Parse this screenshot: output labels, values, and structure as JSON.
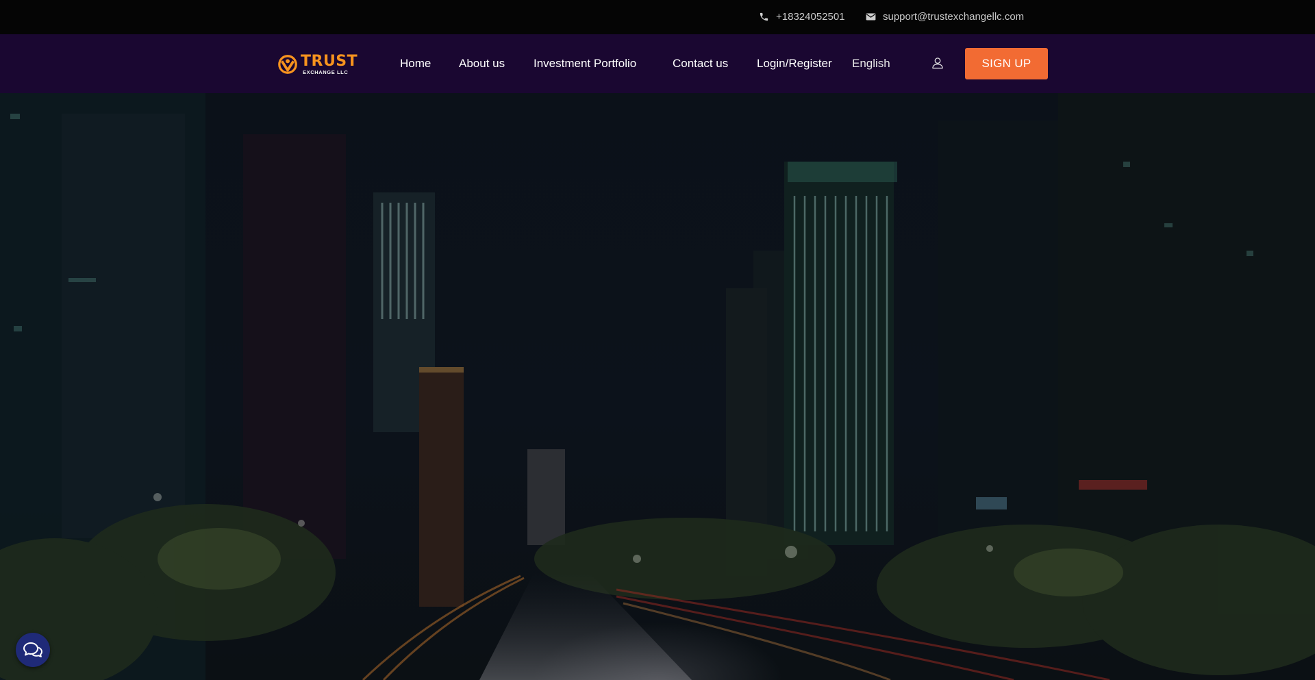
{
  "topbar": {
    "phone": "+18324052501",
    "email": "support@trustexchangellc.com",
    "phone_icon": "phone-icon",
    "email_icon": "envelope-icon"
  },
  "brand": {
    "name": "TRUST",
    "subtitle": "EXCHANGE LLC",
    "accent": "#f7931e"
  },
  "nav": {
    "home": "Home",
    "about": "About us",
    "portfolio": "Investment Portfolio",
    "contact": "Contact us",
    "login": "Login/Register",
    "language": "English",
    "user_icon": "user-icon",
    "signup": "SIGN UP"
  },
  "colors": {
    "topbar_bg": "#050505",
    "navbar_bg": "#1a0731",
    "signup_bg": "#f26b33",
    "chat_bg": "#1f2a78"
  },
  "hero": {
    "image": "night city skyline with light trails"
  },
  "chat": {
    "icon": "chat-bubbles-icon"
  }
}
